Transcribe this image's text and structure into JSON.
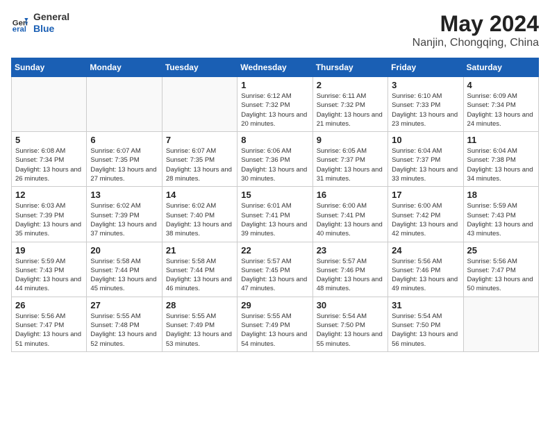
{
  "header": {
    "logo_general": "General",
    "logo_blue": "Blue",
    "title": "May 2024",
    "location": "Nanjin, Chongqing, China"
  },
  "weekdays": [
    "Sunday",
    "Monday",
    "Tuesday",
    "Wednesday",
    "Thursday",
    "Friday",
    "Saturday"
  ],
  "weeks": [
    [
      {
        "day": "",
        "info": ""
      },
      {
        "day": "",
        "info": ""
      },
      {
        "day": "",
        "info": ""
      },
      {
        "day": "1",
        "info": "Sunrise: 6:12 AM\nSunset: 7:32 PM\nDaylight: 13 hours\nand 20 minutes."
      },
      {
        "day": "2",
        "info": "Sunrise: 6:11 AM\nSunset: 7:32 PM\nDaylight: 13 hours\nand 21 minutes."
      },
      {
        "day": "3",
        "info": "Sunrise: 6:10 AM\nSunset: 7:33 PM\nDaylight: 13 hours\nand 23 minutes."
      },
      {
        "day": "4",
        "info": "Sunrise: 6:09 AM\nSunset: 7:34 PM\nDaylight: 13 hours\nand 24 minutes."
      }
    ],
    [
      {
        "day": "5",
        "info": "Sunrise: 6:08 AM\nSunset: 7:34 PM\nDaylight: 13 hours\nand 26 minutes."
      },
      {
        "day": "6",
        "info": "Sunrise: 6:07 AM\nSunset: 7:35 PM\nDaylight: 13 hours\nand 27 minutes."
      },
      {
        "day": "7",
        "info": "Sunrise: 6:07 AM\nSunset: 7:35 PM\nDaylight: 13 hours\nand 28 minutes."
      },
      {
        "day": "8",
        "info": "Sunrise: 6:06 AM\nSunset: 7:36 PM\nDaylight: 13 hours\nand 30 minutes."
      },
      {
        "day": "9",
        "info": "Sunrise: 6:05 AM\nSunset: 7:37 PM\nDaylight: 13 hours\nand 31 minutes."
      },
      {
        "day": "10",
        "info": "Sunrise: 6:04 AM\nSunset: 7:37 PM\nDaylight: 13 hours\nand 33 minutes."
      },
      {
        "day": "11",
        "info": "Sunrise: 6:04 AM\nSunset: 7:38 PM\nDaylight: 13 hours\nand 34 minutes."
      }
    ],
    [
      {
        "day": "12",
        "info": "Sunrise: 6:03 AM\nSunset: 7:39 PM\nDaylight: 13 hours\nand 35 minutes."
      },
      {
        "day": "13",
        "info": "Sunrise: 6:02 AM\nSunset: 7:39 PM\nDaylight: 13 hours\nand 37 minutes."
      },
      {
        "day": "14",
        "info": "Sunrise: 6:02 AM\nSunset: 7:40 PM\nDaylight: 13 hours\nand 38 minutes."
      },
      {
        "day": "15",
        "info": "Sunrise: 6:01 AM\nSunset: 7:41 PM\nDaylight: 13 hours\nand 39 minutes."
      },
      {
        "day": "16",
        "info": "Sunrise: 6:00 AM\nSunset: 7:41 PM\nDaylight: 13 hours\nand 40 minutes."
      },
      {
        "day": "17",
        "info": "Sunrise: 6:00 AM\nSunset: 7:42 PM\nDaylight: 13 hours\nand 42 minutes."
      },
      {
        "day": "18",
        "info": "Sunrise: 5:59 AM\nSunset: 7:43 PM\nDaylight: 13 hours\nand 43 minutes."
      }
    ],
    [
      {
        "day": "19",
        "info": "Sunrise: 5:59 AM\nSunset: 7:43 PM\nDaylight: 13 hours\nand 44 minutes."
      },
      {
        "day": "20",
        "info": "Sunrise: 5:58 AM\nSunset: 7:44 PM\nDaylight: 13 hours\nand 45 minutes."
      },
      {
        "day": "21",
        "info": "Sunrise: 5:58 AM\nSunset: 7:44 PM\nDaylight: 13 hours\nand 46 minutes."
      },
      {
        "day": "22",
        "info": "Sunrise: 5:57 AM\nSunset: 7:45 PM\nDaylight: 13 hours\nand 47 minutes."
      },
      {
        "day": "23",
        "info": "Sunrise: 5:57 AM\nSunset: 7:46 PM\nDaylight: 13 hours\nand 48 minutes."
      },
      {
        "day": "24",
        "info": "Sunrise: 5:56 AM\nSunset: 7:46 PM\nDaylight: 13 hours\nand 49 minutes."
      },
      {
        "day": "25",
        "info": "Sunrise: 5:56 AM\nSunset: 7:47 PM\nDaylight: 13 hours\nand 50 minutes."
      }
    ],
    [
      {
        "day": "26",
        "info": "Sunrise: 5:56 AM\nSunset: 7:47 PM\nDaylight: 13 hours\nand 51 minutes."
      },
      {
        "day": "27",
        "info": "Sunrise: 5:55 AM\nSunset: 7:48 PM\nDaylight: 13 hours\nand 52 minutes."
      },
      {
        "day": "28",
        "info": "Sunrise: 5:55 AM\nSunset: 7:49 PM\nDaylight: 13 hours\nand 53 minutes."
      },
      {
        "day": "29",
        "info": "Sunrise: 5:55 AM\nSunset: 7:49 PM\nDaylight: 13 hours\nand 54 minutes."
      },
      {
        "day": "30",
        "info": "Sunrise: 5:54 AM\nSunset: 7:50 PM\nDaylight: 13 hours\nand 55 minutes."
      },
      {
        "day": "31",
        "info": "Sunrise: 5:54 AM\nSunset: 7:50 PM\nDaylight: 13 hours\nand 56 minutes."
      },
      {
        "day": "",
        "info": ""
      }
    ]
  ]
}
